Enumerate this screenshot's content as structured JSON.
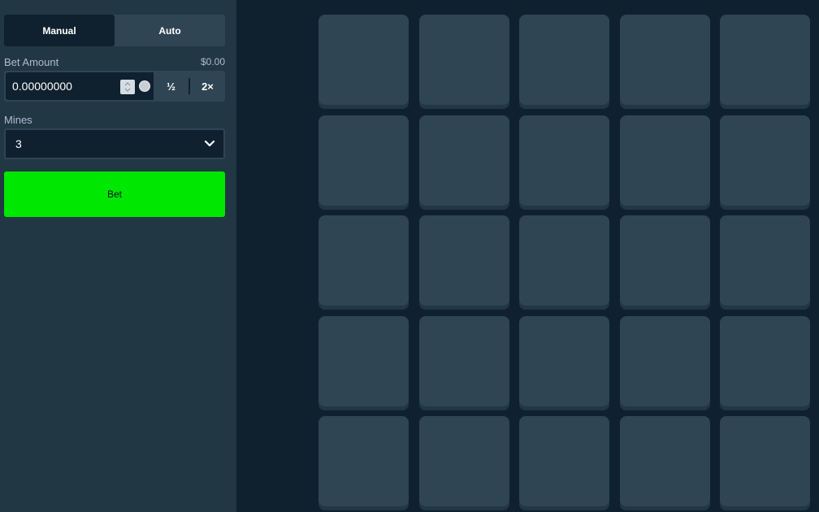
{
  "modes": {
    "manual_label": "Manual",
    "auto_label": "Auto",
    "active": "manual"
  },
  "bet_amount": {
    "label": "Bet Amount",
    "usd_value": "$0.00",
    "value": "0.00000000",
    "half_label": "½",
    "double_label": "2×",
    "coin_icon": "crypto-coin-icon"
  },
  "mines": {
    "label": "Mines",
    "selected": "3"
  },
  "bet_button": {
    "label": "Bet"
  },
  "board": {
    "rows": 5,
    "columns": 5
  },
  "colors": {
    "accent_green": "#00e701",
    "background": "#0f212e",
    "panel": "#213743",
    "tile": "#2f4553"
  }
}
